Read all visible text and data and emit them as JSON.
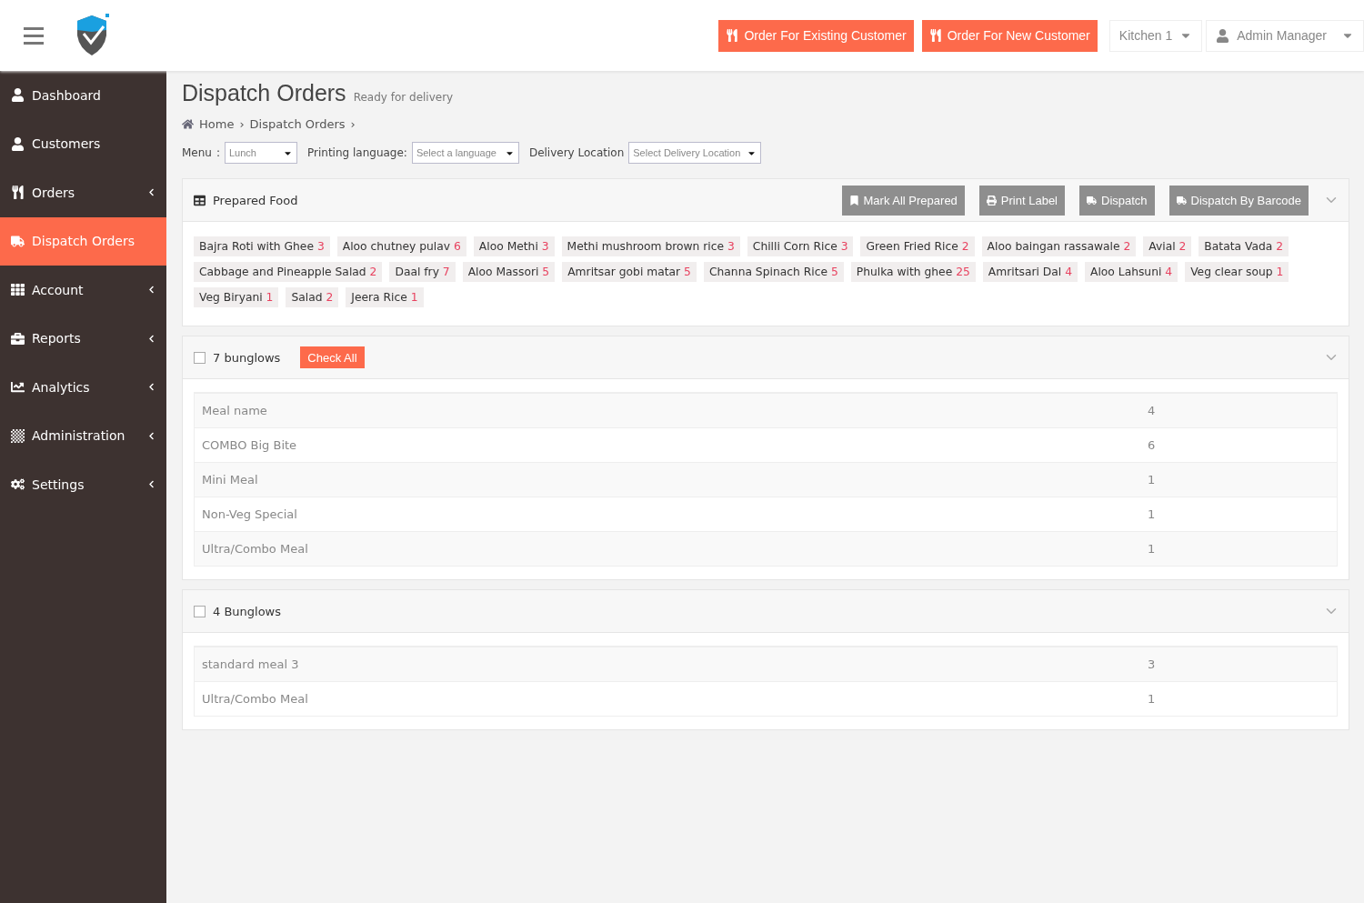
{
  "header": {
    "buttons": [
      {
        "label": "Order For Existing Customer"
      },
      {
        "label": "Order For New Customer"
      }
    ],
    "kitchen": "Kitchen 1",
    "user": "Admin Manager"
  },
  "sidebar": {
    "items": [
      {
        "label": "Dashboard",
        "selected": false,
        "has_submenu": false
      },
      {
        "label": "Customers",
        "selected": false,
        "has_submenu": false
      },
      {
        "label": "Orders",
        "selected": false,
        "has_submenu": true
      },
      {
        "label": "Dispatch Orders",
        "selected": true,
        "has_submenu": false
      },
      {
        "label": "Account",
        "selected": false,
        "has_submenu": true
      },
      {
        "label": "Reports",
        "selected": false,
        "has_submenu": true
      },
      {
        "label": "Analytics",
        "selected": false,
        "has_submenu": true
      },
      {
        "label": "Administration",
        "selected": false,
        "has_submenu": true
      },
      {
        "label": "Settings",
        "selected": false,
        "has_submenu": true
      }
    ]
  },
  "page": {
    "title": "Dispatch Orders",
    "subtitle": "Ready for delivery",
    "breadcrumb": [
      {
        "label": "Home",
        "separator": "›"
      },
      {
        "label": "Dispatch Orders",
        "separator": "›"
      }
    ]
  },
  "filters": [
    {
      "label": "Menu",
      "separator": ":",
      "value": "Lunch"
    },
    {
      "label": "Printing language:",
      "placeholder": "Select a language"
    },
    {
      "label": "Delivery Location",
      "placeholder": "Select Delivery Location"
    }
  ],
  "prepared_food": {
    "title": "Prepared Food",
    "actions": [
      {
        "label": "Mark All Prepared"
      },
      {
        "label": "Print Label"
      },
      {
        "label": "Dispatch"
      },
      {
        "label": "Dispatch By Barcode"
      }
    ],
    "items": [
      {
        "name": "Bajra Roti with Ghee",
        "count": "3"
      },
      {
        "name": "Aloo chutney pulav",
        "count": "6"
      },
      {
        "name": "Aloo Methi",
        "count": "3"
      },
      {
        "name": "Methi mushroom brown rice",
        "count": "3"
      },
      {
        "name": "Chilli Corn Rice",
        "count": "3"
      },
      {
        "name": "Green Fried Rice",
        "count": "2"
      },
      {
        "name": "Aloo baingan rassawale",
        "count": "2"
      },
      {
        "name": "Avial",
        "count": "2"
      },
      {
        "name": "Batata Vada",
        "count": "2"
      },
      {
        "name": "Cabbage and Pineapple Salad",
        "count": "2"
      },
      {
        "name": "Daal fry",
        "count": "7"
      },
      {
        "name": "Aloo Massori",
        "count": "5"
      },
      {
        "name": "Amritsar gobi matar",
        "count": "5"
      },
      {
        "name": "Channa Spinach Rice",
        "count": "5"
      },
      {
        "name": "Phulka with ghee",
        "count": "25"
      },
      {
        "name": "Amritsari Dal",
        "count": "4"
      },
      {
        "name": "Aloo Lahsuni",
        "count": "4"
      },
      {
        "name": "Veg clear soup",
        "count": "1"
      },
      {
        "name": "Veg Biryani",
        "count": "1"
      },
      {
        "name": "Salad",
        "count": "2"
      },
      {
        "name": "Jeera Rice",
        "count": "1"
      }
    ]
  },
  "groups": [
    {
      "title": "7 bunglows",
      "checked": false,
      "check_all": "Check All",
      "rows": [
        {
          "meal": "Meal name",
          "count": "4"
        },
        {
          "meal": "COMBO Big Bite",
          "count": "6"
        },
        {
          "meal": "Mini Meal",
          "count": "1"
        },
        {
          "meal": "Non-Veg Special",
          "count": "1"
        },
        {
          "meal": "Ultra/Combo Meal",
          "count": "1"
        }
      ]
    },
    {
      "title": "4 Bunglows",
      "checked": false,
      "rows": [
        {
          "meal": "standard meal 3",
          "count": "3"
        },
        {
          "meal": "Ultra/Combo Meal",
          "count": "1"
        }
      ]
    }
  ]
}
